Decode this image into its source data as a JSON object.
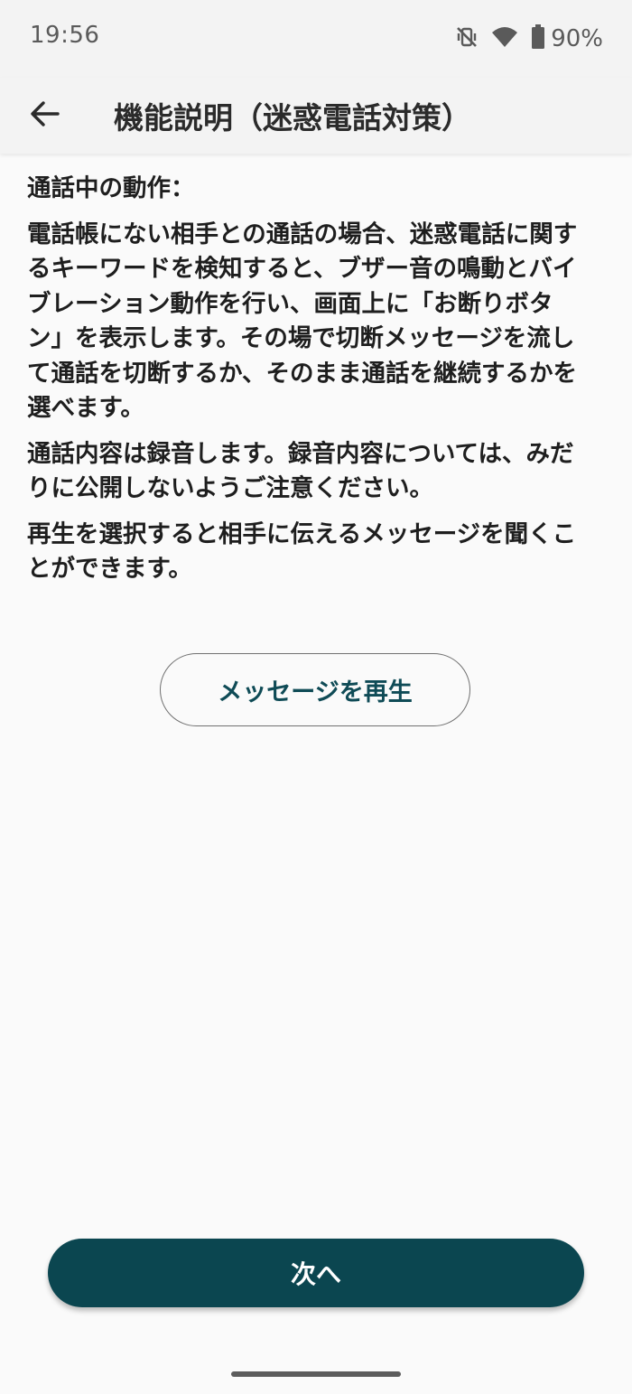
{
  "status_bar": {
    "time": "19:56",
    "battery": "90%",
    "icons": [
      "mute-vibrate-icon",
      "wifi-icon",
      "battery-icon"
    ]
  },
  "app_bar": {
    "back_icon": "arrow-left-icon",
    "title": "機能説明（迷惑電話対策）"
  },
  "content": {
    "heading": "通話中の動作：",
    "paragraphs": [
      "電話帳にない相手との通話の場合、迷惑電話に関するキーワードを検知すると、ブザー音の鳴動とバイブレーション動作を行い、画面上に「お断りボタン」を表示します。その場で切断メッセージを流して通話を切断するか、そのまま通話を継続するかを選べます。",
      "通話内容は録音します。録音内容については、みだりに公開しないようご注意ください。",
      "再生を選択すると相手に伝えるメッセージを聞くことができます。"
    ]
  },
  "play_button": {
    "label": "メッセージを再生"
  },
  "next_button": {
    "label": "次へ"
  },
  "colors": {
    "primary": "#0b4650",
    "play_text": "#0f4b56",
    "background": "#fafafa",
    "bar": "#f3f3f3"
  }
}
